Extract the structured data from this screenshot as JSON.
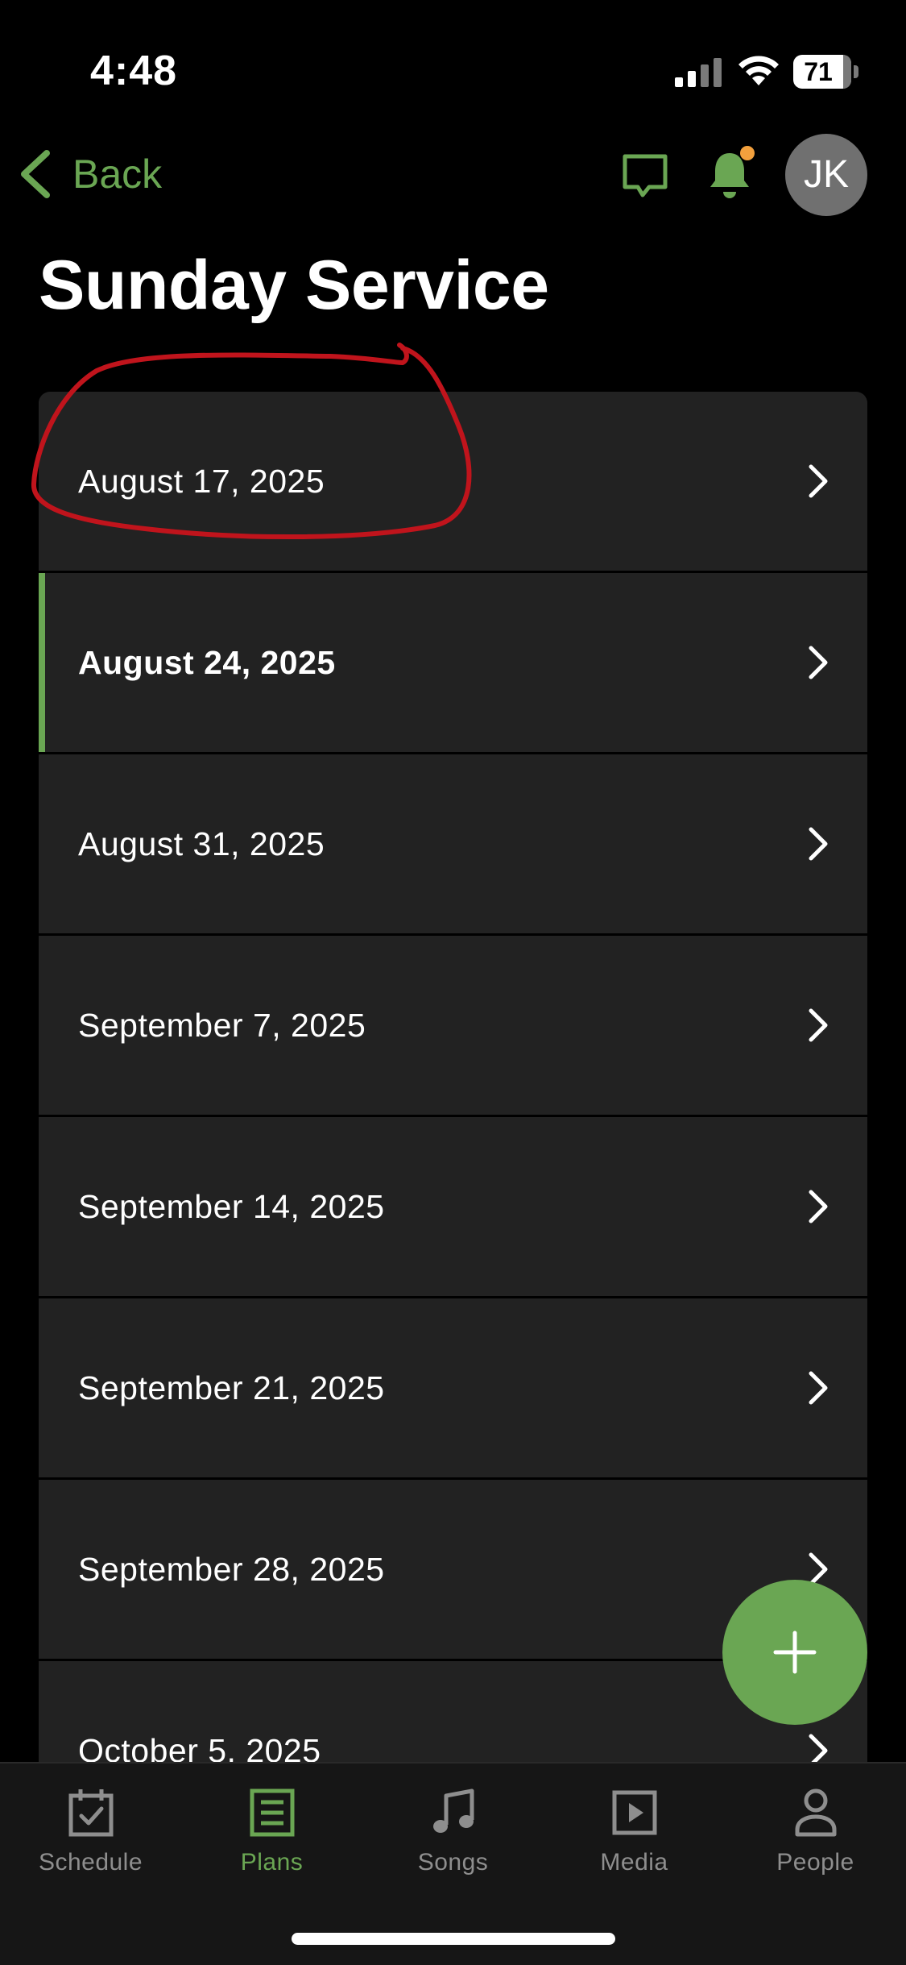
{
  "status_bar": {
    "time": "4:48",
    "battery_level": "71"
  },
  "nav": {
    "back_label": "Back",
    "avatar_initials": "JK",
    "notification_badge_color": "#f2a03d"
  },
  "page": {
    "title": "Sunday Service"
  },
  "plans": [
    {
      "date": "August 17, 2025"
    },
    {
      "date": "August 24, 2025",
      "current": true
    },
    {
      "date": "August 31, 2025"
    },
    {
      "date": "September 7, 2025"
    },
    {
      "date": "September 14, 2025"
    },
    {
      "date": "September 21, 2025"
    },
    {
      "date": "September 28, 2025"
    },
    {
      "date": "October 5, 2025"
    }
  ],
  "tabs": [
    {
      "label": "Schedule",
      "icon": "calendar-check-icon"
    },
    {
      "label": "Plans",
      "icon": "plans-list-icon",
      "active": true
    },
    {
      "label": "Songs",
      "icon": "music-note-icon"
    },
    {
      "label": "Media",
      "icon": "play-box-icon"
    },
    {
      "label": "People",
      "icon": "person-icon"
    }
  ],
  "colors": {
    "accent": "#6aa653",
    "row_background": "#222222",
    "annotation": "#c0141c",
    "inactive_tab": "#8e8e8e"
  }
}
